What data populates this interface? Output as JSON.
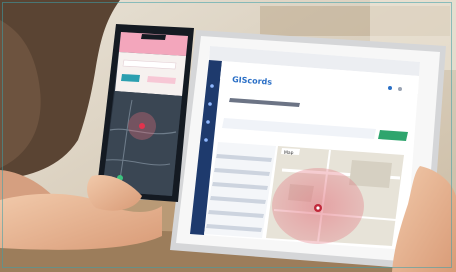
{
  "scene": {
    "caption": "",
    "colors": {
      "wood": "#a88a67",
      "teal": "#2b9fb0",
      "navy": "#1e3a6d",
      "map_circle": "#e26c78",
      "pink": "#f3a6bc"
    }
  },
  "phone": {
    "app_title": "",
    "items": [
      "",
      ""
    ]
  },
  "tablet": {
    "logo": "GIScords",
    "url": "",
    "page_heading": "",
    "filter_button": "",
    "map_tabs": [
      "Map",
      ""
    ],
    "sidebar_rows": [
      "",
      "",
      "",
      "",
      "",
      "",
      ""
    ]
  }
}
